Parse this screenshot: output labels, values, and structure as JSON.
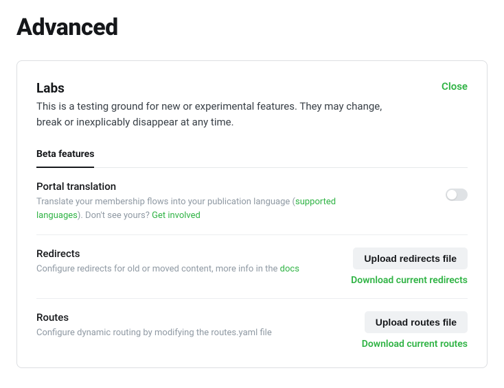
{
  "page": {
    "title": "Advanced"
  },
  "card": {
    "title": "Labs",
    "description": "This is a testing ground for new or experimental features. They may change, break or inexplicably disappear at any time.",
    "close_label": "Close"
  },
  "tabs": {
    "beta_features": "Beta features"
  },
  "sections": {
    "portal_translation": {
      "title": "Portal translation",
      "desc_before": "Translate your membership flows into your publication language (",
      "supported_link": "supported languages",
      "desc_mid": "). Don't see yours? ",
      "involved_link": "Get involved"
    },
    "redirects": {
      "title": "Redirects",
      "desc_before": "Configure redirects for old or moved content, more info in the ",
      "docs_link": "docs",
      "upload_label": "Upload redirects file",
      "download_label": "Download current redirects"
    },
    "routes": {
      "title": "Routes",
      "desc": "Configure dynamic routing by modifying the routes.yaml file",
      "upload_label": "Upload routes file",
      "download_label": "Download current routes"
    }
  }
}
